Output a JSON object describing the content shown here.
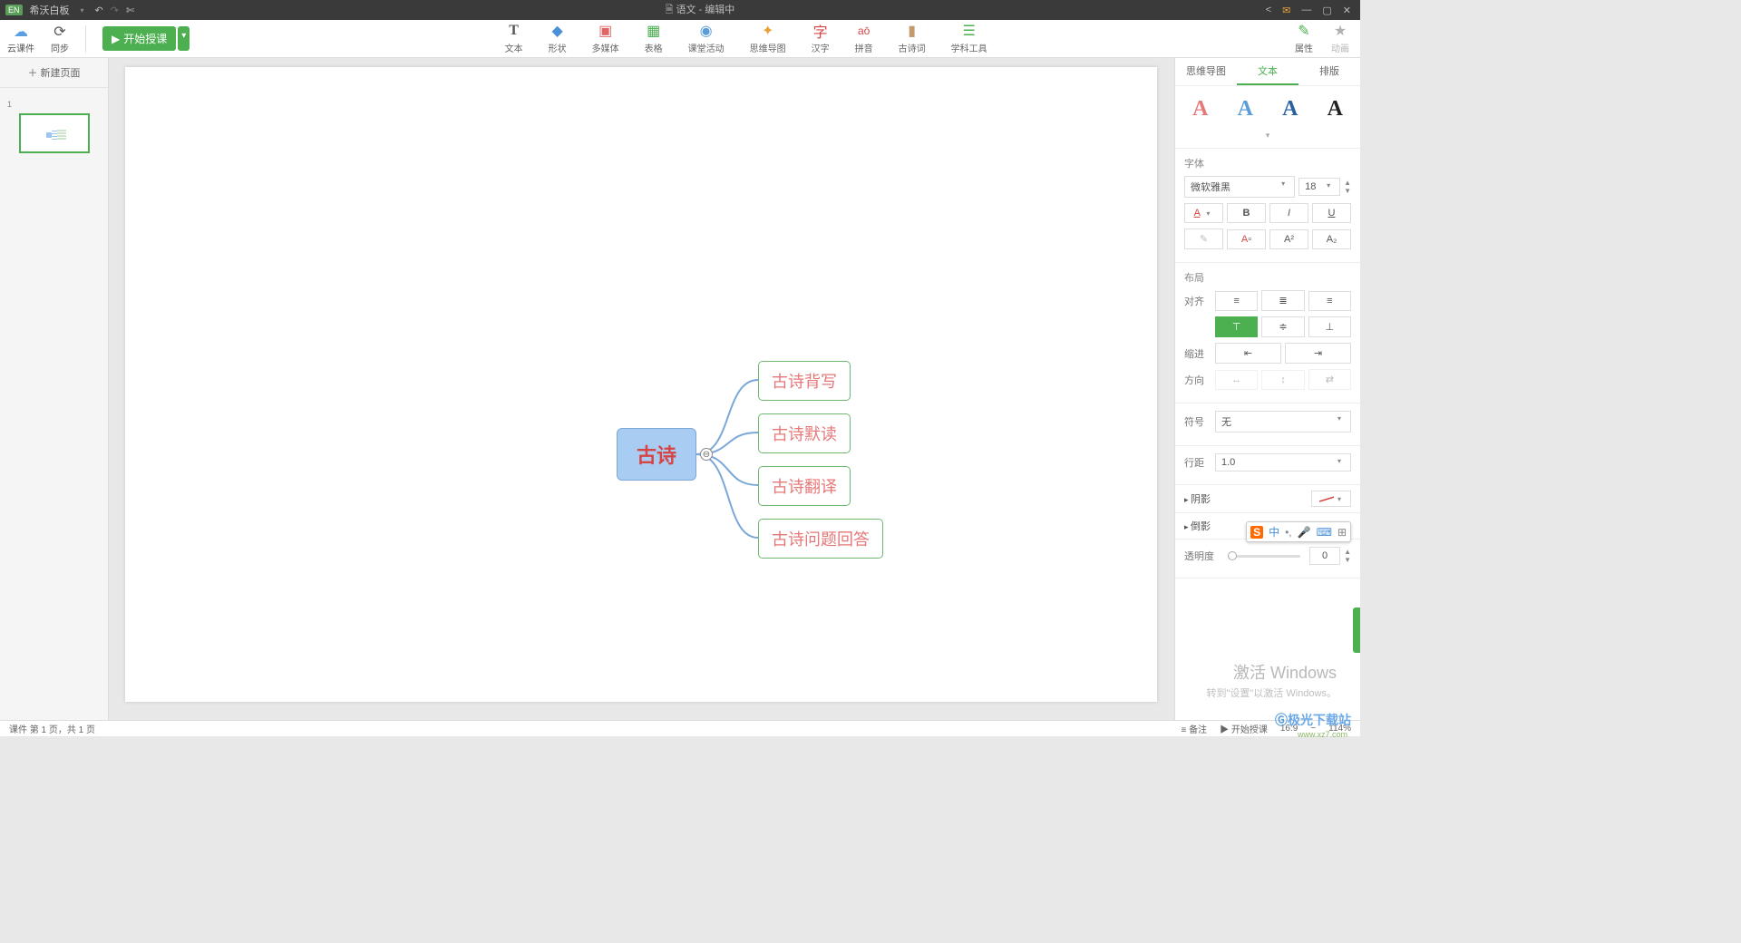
{
  "titlebar": {
    "badge": "EN",
    "app_name": "希沃白板",
    "doc_name": "语文",
    "doc_status": "编辑中"
  },
  "toolbar_left": {
    "cloud": "云课件",
    "sync": "同步",
    "start_lesson": "开始授课"
  },
  "tools": {
    "text": "文本",
    "shape": "形状",
    "media": "多媒体",
    "table": "表格",
    "activity": "课堂活动",
    "mindmap": "思维导图",
    "hanzi": "汉字",
    "pinyin": "拼音",
    "poem": "古诗词",
    "subject": "学科工具"
  },
  "toolbar_right": {
    "properties": "属性",
    "animation": "动画"
  },
  "left_panel": {
    "new_page": "新建页面",
    "thumb_index": "1"
  },
  "mindmap": {
    "root": "古诗",
    "collapse": "⊖",
    "children": [
      "古诗背写",
      "古诗默读",
      "古诗翻译",
      "古诗问题回答"
    ]
  },
  "right_panel": {
    "tabs": {
      "mindmap": "思维导图",
      "text": "文本",
      "layout": "排版"
    },
    "font_section": "字体",
    "font_family": "微软雅黑",
    "font_size": "18",
    "layout_section": "布局",
    "align": "对齐",
    "indent": "缩进",
    "direction": "方向",
    "symbol": "符号",
    "symbol_val": "无",
    "line_spacing": "行距",
    "line_spacing_val": "1.0",
    "shadow": "阴影",
    "reflection": "倒影",
    "opacity": "透明度",
    "opacity_val": "0"
  },
  "statusbar": {
    "page_info": "课件 第 1 页，共 1 页",
    "remark": "备注",
    "start": "开始授课",
    "ratio": "16:9",
    "zoom": "114%"
  },
  "watermark": {
    "w1": "激活 Windows",
    "w2": "转到\"设置\"以激活 Windows。",
    "w3": "极光下载站",
    "w4": "www.xz7.com"
  },
  "ime": {
    "s": "S",
    "zhong": "中"
  }
}
